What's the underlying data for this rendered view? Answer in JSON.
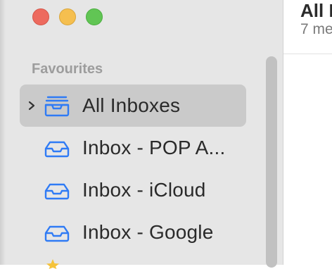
{
  "window": {
    "traffic_lights": {
      "close_color": "#ed6a5e",
      "minimize_color": "#f5bf4f",
      "zoom_color": "#61c554"
    }
  },
  "sidebar": {
    "section_title": "Favourites",
    "items": [
      {
        "label": "All Inboxes",
        "icon": "tray-stack-icon",
        "selected": true,
        "expandable": true
      },
      {
        "label": "Inbox - POP A...",
        "icon": "tray-icon",
        "selected": false
      },
      {
        "label": "Inbox - iCloud",
        "icon": "tray-icon",
        "selected": false
      },
      {
        "label": "Inbox - Google",
        "icon": "tray-icon",
        "selected": false
      }
    ],
    "accent_color": "#2f7bf5"
  },
  "message_list": {
    "title": "All I",
    "subtitle": "7 me"
  }
}
